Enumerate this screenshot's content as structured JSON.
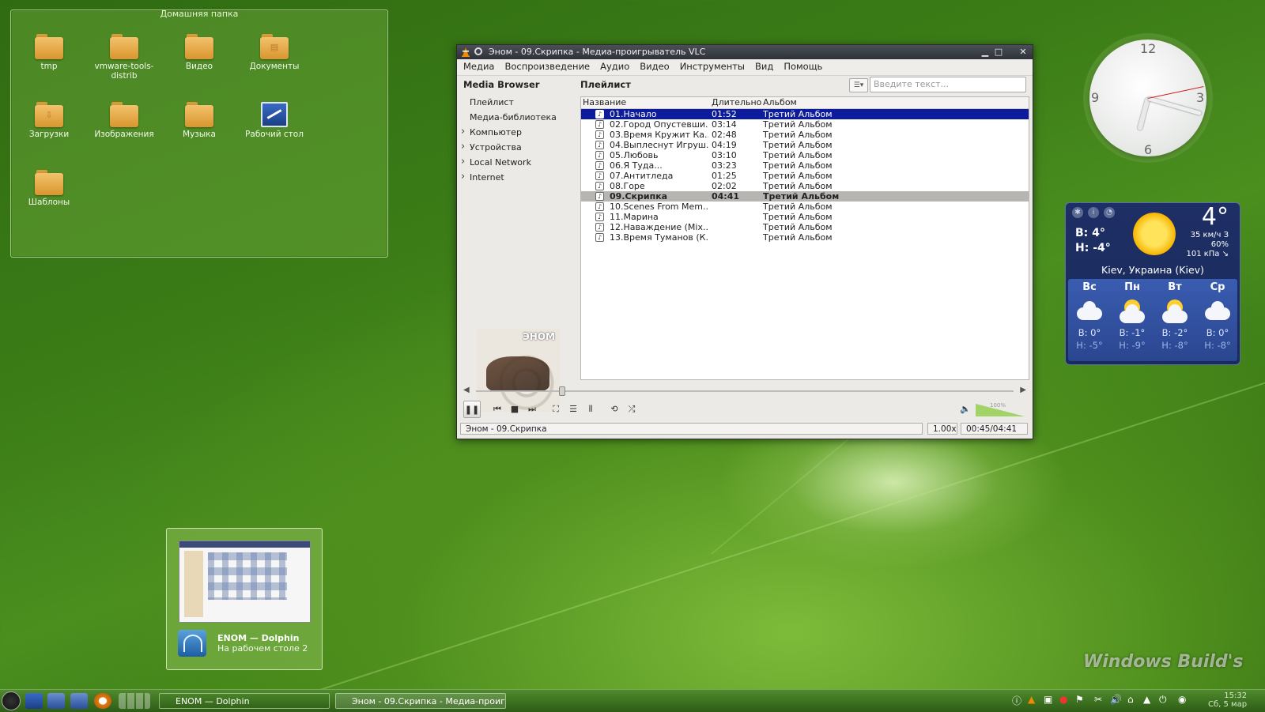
{
  "folderview": {
    "title": "Домашняя папка",
    "items": [
      {
        "label": "tmp"
      },
      {
        "label": "vmware-tools-distrib"
      },
      {
        "label": "Видео"
      },
      {
        "label": "Документы"
      },
      {
        "label": "Загрузки"
      },
      {
        "label": "Изображения"
      },
      {
        "label": "Музыка"
      },
      {
        "label": "Рабочий стол"
      },
      {
        "label": "Шаблоны"
      }
    ]
  },
  "vlc": {
    "title": "Эном - 09.Скрипка - Медиа-проигрыватель VLC",
    "menu": [
      "Медиа",
      "Воспроизведение",
      "Аудио",
      "Видео",
      "Инструменты",
      "Вид",
      "Помощь"
    ],
    "sidebar": {
      "heading": "Media Browser",
      "items": [
        "Плейлист",
        "Медиа-библиотека",
        "Компьютер",
        "Устройства",
        "Local Network",
        "Internet"
      ]
    },
    "album_caption": "ЭНОМ",
    "playlist": {
      "title": "Плейлист",
      "search_placeholder": "Введите текст...",
      "columns": [
        "Название",
        "Длительно",
        "Альбом"
      ],
      "rows": [
        {
          "title": "01.Начало",
          "duration": "01:52",
          "album": "Третий Альбом"
        },
        {
          "title": "02.Город Опустевши...",
          "duration": "03:14",
          "album": "Третий Альбом"
        },
        {
          "title": "03.Время Кружит Ка...",
          "duration": "02:48",
          "album": "Третий Альбом"
        },
        {
          "title": "04.Выплеснут Игруш...",
          "duration": "04:19",
          "album": "Третий Альбом"
        },
        {
          "title": "05.Любовь",
          "duration": "03:10",
          "album": "Третий Альбом"
        },
        {
          "title": "06.Я Туда...",
          "duration": "03:23",
          "album": "Третий Альбом"
        },
        {
          "title": "07.Антитледа",
          "duration": "01:25",
          "album": "Третий Альбом"
        },
        {
          "title": "08.Горе",
          "duration": "02:02",
          "album": "Третий Альбом"
        },
        {
          "title": "09.Скрипка",
          "duration": "04:41",
          "album": "Третий Альбом"
        },
        {
          "title": "10.Scenes From Mem...",
          "duration": "",
          "album": "Третий Альбом"
        },
        {
          "title": "11.Марина",
          "duration": "",
          "album": "Третий Альбом"
        },
        {
          "title": "12.Наваждение (Mix...",
          "duration": "",
          "album": "Третий Альбом"
        },
        {
          "title": "13.Время Туманов (К...",
          "duration": "",
          "album": "Третий Альбом"
        }
      ]
    },
    "seek_progress": 0.16,
    "volume_label": "100%",
    "status": {
      "now_playing": "Эном - 09.Скрипка",
      "speed": "1.00x",
      "time": "00:45/04:41"
    }
  },
  "clock": {
    "n12": "12",
    "n3": "3",
    "n6": "6",
    "n9": "9"
  },
  "weather": {
    "temp": "4°",
    "high": "В: 4°",
    "low": "Н: -4°",
    "wind": "35 км/ч З",
    "humidity": "60%",
    "pressure": "101 кПа ↘",
    "location": "Kiev, Украина (Kiev)",
    "days": [
      {
        "name": "Вс",
        "high": "В: 0°",
        "low": "Н: -5°",
        "icon": "snow-cloud-icon"
      },
      {
        "name": "Пн",
        "high": "В: -1°",
        "low": "Н: -9°",
        "icon": "partly-sunny-icon"
      },
      {
        "name": "Вт",
        "high": "В: -2°",
        "low": "Н: -8°",
        "icon": "partly-sunny-icon"
      },
      {
        "name": "Ср",
        "high": "В: 0°",
        "low": "Н: -8°",
        "icon": "cloud-icon"
      }
    ]
  },
  "preview": {
    "title": "ENOM — Dolphin",
    "subtitle": "На рабочем столе 2"
  },
  "taskbar": {
    "tasks": [
      "ENOM — Dolphin",
      "Эном - 09.Скрипка - Медиа-проигрыв"
    ],
    "time": "15:32",
    "date": "Сб, 5 мар"
  },
  "watermark": "Windows Build's"
}
